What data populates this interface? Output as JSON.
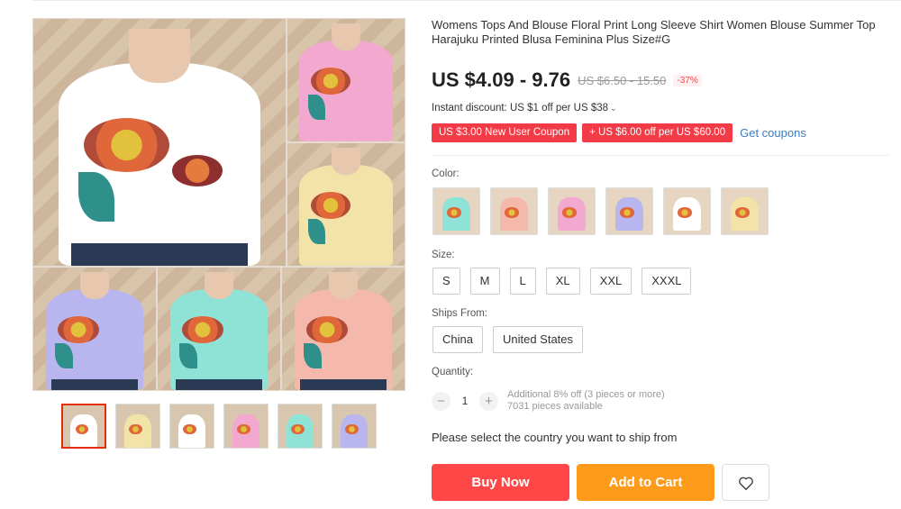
{
  "product": {
    "title": "Womens Tops And Blouse Floral Print Long Sleeve Shirt Women Blouse Summer Top Harajuku Printed Blusa Feminina Plus Size#G",
    "price": "US $4.09 - 9.76",
    "original_price": "US $6.50 - 15.50",
    "discount": "-37%",
    "instant_discount": "Instant discount: US $1 off per US $38",
    "coupons": [
      "US $3.00 New User Coupon",
      "+ US $6.00 off per US $60.00"
    ],
    "get_coupons_label": "Get coupons"
  },
  "gallery": {
    "main_tiles": [
      "#ffffff",
      "#f3a8cf",
      "#f3e3a8",
      "#b9b6ef",
      "#8fe3d6",
      "#f5b8ad"
    ],
    "thumbnails": [
      "#ffffff",
      "#f3e3a8",
      "#ffffff",
      "#f3a8cf",
      "#8fe3d6",
      "#b9b6ef"
    ]
  },
  "options": {
    "color_label": "Color:",
    "colors": [
      "#8fe3d6",
      "#f5b8ad",
      "#f3a8cf",
      "#b9b6ef",
      "#ffffff",
      "#f3e3a8"
    ],
    "size_label": "Size:",
    "sizes": [
      "S",
      "M",
      "L",
      "XL",
      "XXL",
      "XXXL"
    ],
    "ships_label": "Ships From:",
    "ships_from": [
      "China",
      "United States"
    ]
  },
  "quantity": {
    "label": "Quantity:",
    "minus": "−",
    "value": "1",
    "plus": "+",
    "info_line1": "Additional 8% off (3 pieces or more)",
    "info_line2": "7031 pieces available"
  },
  "ship_message": "Please select the country you want to ship from",
  "actions": {
    "buy_now": "Buy Now",
    "add_to_cart": "Add to Cart"
  }
}
